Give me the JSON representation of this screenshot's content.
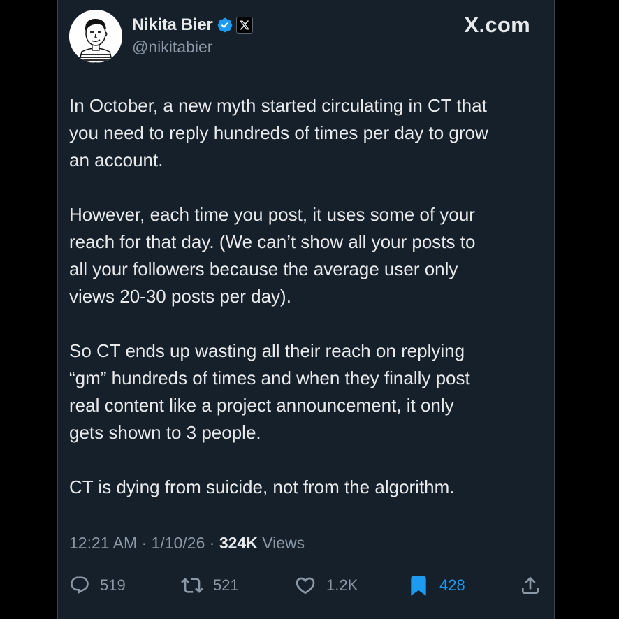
{
  "author": {
    "display_name": "Nikita Bier",
    "handle": "@nikitabier",
    "verified_color": "#1d9bf0"
  },
  "brand": "X.com",
  "tweet": {
    "paragraphs": [
      "In October, a new myth started circulating in CT that\nyou need to reply hundreds of times per day to grow\nan account.",
      "However, each time you post, it uses some of your\nreach for that day. (We can’t show all your posts to\nall your followers because the average user only\nviews 20-30 posts per day).",
      "So CT ends up wasting all their reach on replying\n“gm” hundreds of times and when they finally post\nreal content like a project announcement, it only\ngets shown to 3 people.",
      "CT is dying from suicide, not from the algorithm."
    ]
  },
  "meta": {
    "time": "12:21 AM",
    "sep1": " · ",
    "date": "1/10/26",
    "sep2": " · ",
    "views_count": "324K",
    "views_label": " Views"
  },
  "actions": {
    "replies": "519",
    "reposts": "521",
    "likes": "1.2K",
    "bookmarks": "428"
  },
  "colors": {
    "background": "#15202b",
    "text": "#e7e9ea",
    "secondary": "#8b98a5",
    "accent": "#1d9bf0"
  },
  "icons": [
    "verified-icon",
    "x-logo-icon",
    "reply-icon",
    "repost-icon",
    "like-icon",
    "bookmark-icon",
    "share-icon"
  ]
}
